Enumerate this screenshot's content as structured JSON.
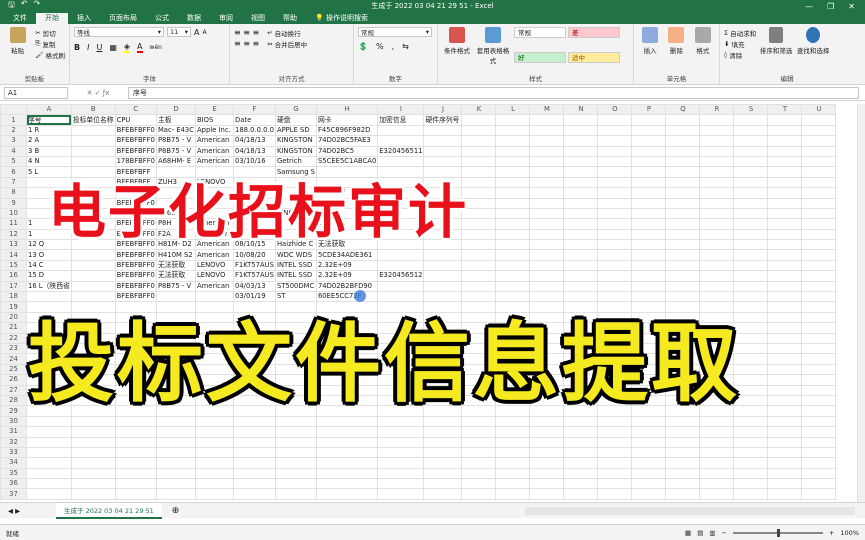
{
  "window": {
    "title": "生成于 2022 03 04 21 29 51  -  Excel",
    "controls": [
      "—",
      "❐",
      "✕"
    ]
  },
  "tabs": [
    "文件",
    "开始",
    "插入",
    "页面布局",
    "公式",
    "数据",
    "审阅",
    "视图",
    "帮助"
  ],
  "tell_me": "操作说明搜索",
  "ribbon": {
    "clipboard": {
      "label": "剪贴板",
      "paste": "粘贴",
      "cut": "剪切",
      "copy": "复制",
      "format_painter": "格式刷"
    },
    "font": {
      "label": "字体",
      "name": "等线",
      "size": "11",
      "bold": "B",
      "italic": "I",
      "underline": "U",
      "grow": "A",
      "shrink": "A",
      "wen": "wén"
    },
    "alignment": {
      "label": "对齐方式",
      "wrap": "自动换行",
      "merge": "合并后居中"
    },
    "number": {
      "label": "数字",
      "format": "常规",
      "percent": "%",
      "comma": ","
    },
    "styles": {
      "label": "样式",
      "conditional": "条件格式",
      "table": "套用表格格式",
      "cells": [
        "常规",
        "差",
        "好",
        "适中"
      ]
    },
    "cells": {
      "label": "单元格",
      "insert": "插入",
      "delete": "删除",
      "format": "格式"
    },
    "editing": {
      "label": "编辑",
      "autosum": "自动求和",
      "fill": "填充",
      "clear": "清除",
      "sort": "排序和筛选",
      "find": "查找和选择"
    }
  },
  "formula_bar": {
    "name_box": "A1",
    "content": "序号"
  },
  "columns": [
    "A",
    "B",
    "C",
    "D",
    "E",
    "F",
    "G",
    "H",
    "I",
    "J",
    "K",
    "L",
    "M",
    "N",
    "O",
    "P",
    "Q",
    "R",
    "S",
    "T",
    "U"
  ],
  "rows": [
    [
      "序号",
      "投标单位名称",
      "CPU",
      "主板",
      "BIOS",
      "Date",
      "硬盘",
      "网卡",
      "加密信息",
      "硬件序列号",
      "",
      "",
      "",
      "",
      "",
      "",
      "",
      "",
      "",
      "",
      ""
    ],
    [
      "1 R",
      "",
      "BFEBFBFF0",
      "Mac- E43C",
      "Apple Inc.",
      "188.0.0.0.0",
      "APPLE SD",
      "F45C896F982D",
      "",
      "",
      "",
      "",
      "",
      "",
      "",
      "",
      "",
      "",
      "",
      "",
      ""
    ],
    [
      "2 A",
      "",
      "BFEBFBFF0",
      "P8B75 - V",
      "American",
      "04/18/13",
      "KINGSTON",
      "74D02BC5FAE3",
      "",
      "",
      "",
      "",
      "",
      "",
      "",
      "",
      "",
      "",
      "",
      "",
      ""
    ],
    [
      "3 B",
      "",
      "BFEBFBFF0",
      "P8B75 - V",
      "American",
      "04/18/13",
      "KINGSTON",
      "74D02BC5",
      "E320456511",
      "",
      "",
      "",
      "",
      "",
      "",
      "",
      "",
      "",
      "",
      "",
      ""
    ],
    [
      "4 N",
      "",
      "178BFBFF0",
      "A68HM- E",
      "American",
      "03/10/16",
      "Getrich",
      "S5CEE5C1ABCA0",
      "",
      "",
      "",
      "",
      "",
      "",
      "",
      "",
      "",
      "",
      "",
      "",
      ""
    ],
    [
      "5 L",
      "",
      "BFEBFBFF",
      "",
      "",
      "",
      "Samsung S",
      "",
      "",
      "",
      "",
      "",
      "",
      "",
      "",
      "",
      "",
      "",
      "",
      "",
      ""
    ],
    [
      "",
      "",
      "BFEBFBFF",
      "ZUH3",
      "LENOVO",
      "",
      "",
      "",
      "",
      "",
      "",
      "",
      "",
      "",
      "",
      "",
      "",
      "",
      "",
      "",
      ""
    ],
    [
      "",
      "",
      "BFEBFBFF0",
      "",
      "",
      "",
      "",
      "000DDF",
      "",
      "",
      "",
      "",
      "",
      "",
      "",
      "",
      "",
      "",
      "",
      "",
      ""
    ],
    [
      "",
      "",
      "BFEBFBFF0",
      "",
      "",
      "",
      "",
      "00",
      "",
      "",
      "",
      "",
      "",
      "",
      "",
      "",
      "",
      "",
      "",
      "",
      ""
    ],
    [
      "",
      "",
      "BFEBFBFF0",
      "B365",
      "",
      "",
      "KINGSTO",
      "",
      "",
      "",
      "",
      "",
      "",
      "",
      "",
      "",
      "",
      "",
      "",
      "",
      ""
    ],
    [
      "1",
      "",
      "BFEBFBFF0",
      "P8H",
      "American",
      "",
      "",
      "E8",
      "",
      "",
      "",
      "",
      "",
      "",
      "",
      "",
      "",
      "",
      "",
      "",
      ""
    ],
    [
      "1",
      "",
      "BFEBFBFF0",
      "F2A",
      "American",
      "",
      "",
      "",
      "",
      "",
      "",
      "",
      "",
      "",
      "",
      "",
      "",
      "",
      "",
      "",
      ""
    ],
    [
      "12 Q",
      "",
      "BFEBFBFF0",
      "H81M- D2",
      "American",
      "08/10/15",
      "Haizhide C",
      "无法获取",
      "",
      "",
      "",
      "",
      "",
      "",
      "",
      "",
      "",
      "",
      "",
      "",
      ""
    ],
    [
      "13 O",
      "",
      "BFEBFBFF0",
      "H410M S2",
      "American",
      "10/08/20",
      "WDC WDS",
      "5CDE34ADE361",
      "",
      "",
      "",
      "",
      "",
      "",
      "",
      "",
      "",
      "",
      "",
      "",
      ""
    ],
    [
      "14 C",
      "",
      "BFEBFBFF0",
      "无法获取",
      "LENOVO",
      "F1KT57AUS",
      "INTEL SSD",
      "2.32E+09",
      "",
      "",
      "",
      "",
      "",
      "",
      "",
      "",
      "",
      "",
      "",
      "",
      ""
    ],
    [
      "15 D",
      "",
      "BFEBFBFF0",
      "无法获取",
      "LENOVO",
      "F1KT57AUS",
      "INTEL SSD",
      "2.32E+09",
      "E320456512",
      "",
      "",
      "",
      "",
      "",
      "",
      "",
      "",
      "",
      "",
      "",
      ""
    ],
    [
      "16 L（陕西省",
      "",
      "BFEBFBFF0",
      "P8B75 - V",
      "American",
      "04/03/13",
      "ST500DMC",
      "74D02B2BFD90",
      "",
      "",
      "",
      "",
      "",
      "",
      "",
      "",
      "",
      "",
      "",
      "",
      ""
    ],
    [
      "",
      "",
      "BFEBFBFF0",
      "",
      "",
      "03/01/19",
      "ST",
      "60EE5CC72F",
      "",
      "",
      "",
      "",
      "",
      "",
      "",
      "",
      "",
      "",
      "",
      "",
      ""
    ],
    [
      "",
      "",
      "",
      "",
      "",
      "",
      "",
      "",
      "",
      "",
      "",
      "",
      "",
      "",
      "",
      "",
      "",
      "",
      "",
      "",
      ""
    ],
    [
      "",
      "",
      "",
      "",
      "",
      "",
      "",
      "",
      "",
      "",
      "",
      "",
      "",
      "",
      "",
      "",
      "",
      "",
      "",
      "",
      ""
    ],
    [
      "",
      "",
      "",
      "",
      "",
      "",
      "",
      "",
      "",
      "",
      "",
      "",
      "",
      "",
      "",
      "",
      "",
      "",
      "",
      "",
      ""
    ],
    [
      "",
      "",
      "",
      "",
      "",
      "",
      "",
      "",
      "",
      "",
      "",
      "",
      "",
      "",
      "",
      "",
      "",
      "",
      "",
      "",
      ""
    ],
    [
      "",
      "",
      "",
      "",
      "",
      "",
      "",
      "",
      "",
      "",
      "",
      "",
      "",
      "",
      "",
      "",
      "",
      "",
      "",
      "",
      ""
    ],
    [
      "",
      "",
      "",
      "",
      "",
      "",
      "",
      "",
      "",
      "",
      "",
      "",
      "",
      "",
      "",
      "",
      "",
      "",
      "",
      "",
      ""
    ],
    [
      "",
      "",
      "",
      "",
      "",
      "",
      "",
      "",
      "",
      "",
      "",
      "",
      "",
      "",
      "",
      "",
      "",
      "",
      "",
      "",
      ""
    ],
    [
      "",
      "",
      "",
      "",
      "",
      "",
      "",
      "",
      "",
      "",
      "",
      "",
      "",
      "",
      "",
      "",
      "",
      "",
      "",
      "",
      ""
    ],
    [
      "",
      "",
      "",
      "",
      "",
      "",
      "",
      "",
      "",
      "",
      "",
      "",
      "",
      "",
      "",
      "",
      "",
      "",
      "",
      "",
      ""
    ],
    [
      "",
      "",
      "",
      "",
      "",
      "",
      "",
      "",
      "",
      "",
      "",
      "",
      "",
      "",
      "",
      "",
      "",
      "",
      "",
      "",
      ""
    ],
    [
      "",
      "",
      "",
      "",
      "",
      "",
      "",
      "",
      "",
      "",
      "",
      "",
      "",
      "",
      "",
      "",
      "",
      "",
      "",
      "",
      ""
    ],
    [
      "",
      "",
      "",
      "",
      "",
      "",
      "",
      "",
      "",
      "",
      "",
      "",
      "",
      "",
      "",
      "",
      "",
      "",
      "",
      "",
      ""
    ],
    [
      "",
      "",
      "",
      "",
      "",
      "",
      "",
      "",
      "",
      "",
      "",
      "",
      "",
      "",
      "",
      "",
      "",
      "",
      "",
      "",
      ""
    ],
    [
      "",
      "",
      "",
      "",
      "",
      "",
      "",
      "",
      "",
      "",
      "",
      "",
      "",
      "",
      "",
      "",
      "",
      "",
      "",
      "",
      ""
    ],
    [
      "",
      "",
      "",
      "",
      "",
      "",
      "",
      "",
      "",
      "",
      "",
      "",
      "",
      "",
      "",
      "",
      "",
      "",
      "",
      "",
      ""
    ],
    [
      "",
      "",
      "",
      "",
      "",
      "",
      "",
      "",
      "",
      "",
      "",
      "",
      "",
      "",
      "",
      "",
      "",
      "",
      "",
      "",
      ""
    ],
    [
      "",
      "",
      "",
      "",
      "",
      "",
      "",
      "",
      "",
      "",
      "",
      "",
      "",
      "",
      "",
      "",
      "",
      "",
      "",
      "",
      ""
    ],
    [
      "",
      "",
      "",
      "",
      "",
      "",
      "",
      "",
      "",
      "",
      "",
      "",
      "",
      "",
      "",
      "",
      "",
      "",
      "",
      "",
      ""
    ],
    [
      "",
      "",
      "",
      "",
      "",
      "",
      "",
      "",
      "",
      "",
      "",
      "",
      "",
      "",
      "",
      "",
      "",
      "",
      "",
      "",
      ""
    ]
  ],
  "sheet_tab": "生成于 2022 03 04 21 29 51",
  "status": {
    "left": "就绪",
    "zoom": "100%"
  },
  "overlay": {
    "red_title": "电子化招标审计",
    "yellow_title": "投标文件信息提取"
  },
  "colors": {
    "excel_green": "#217346",
    "overlay_red": "#e8101a",
    "overlay_yellow": "#f5ea20"
  }
}
